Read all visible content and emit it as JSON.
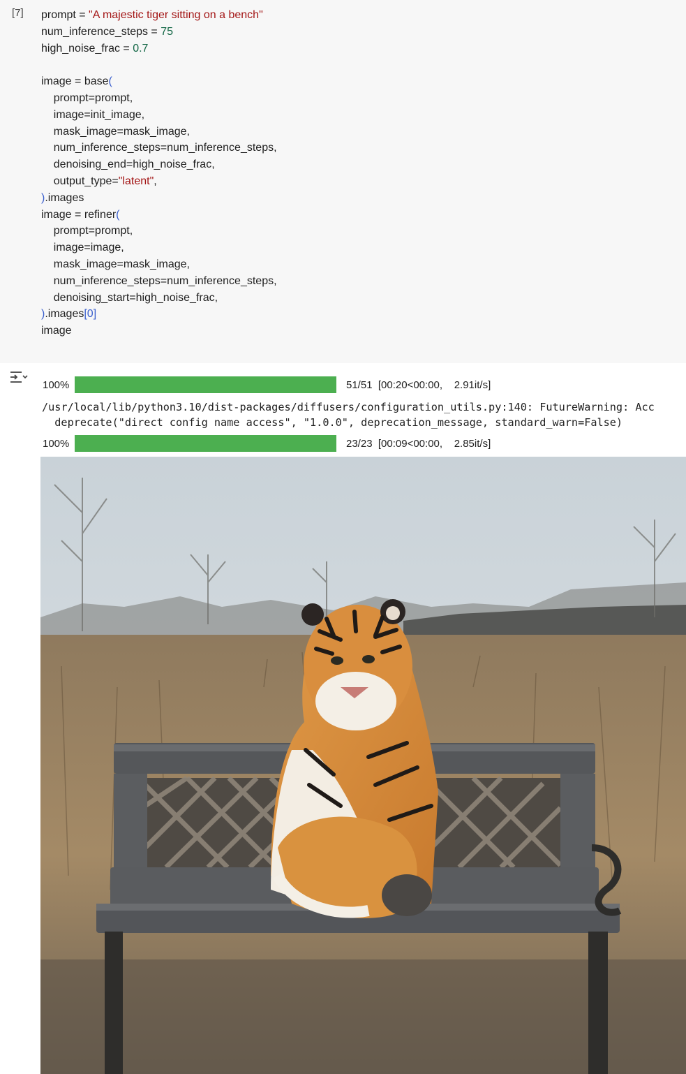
{
  "cell": {
    "execution_count": "[7]",
    "code_lines": [
      [
        {
          "t": "prompt = "
        },
        {
          "t": "\"A majestic tiger sitting on a bench\"",
          "c": "str"
        }
      ],
      [
        {
          "t": "num_inference_steps = "
        },
        {
          "t": "75",
          "c": "num"
        }
      ],
      [
        {
          "t": "high_noise_frac = "
        },
        {
          "t": "0.7",
          "c": "num"
        }
      ],
      [],
      [
        {
          "t": "image = base"
        },
        {
          "t": "(",
          "c": "paren"
        }
      ],
      [
        {
          "t": "    prompt=prompt,"
        }
      ],
      [
        {
          "t": "    image=init_image,"
        }
      ],
      [
        {
          "t": "    mask_image=mask_image,"
        }
      ],
      [
        {
          "t": "    num_inference_steps=num_inference_steps,"
        }
      ],
      [
        {
          "t": "    denoising_end=high_noise_frac,"
        }
      ],
      [
        {
          "t": "    output_type="
        },
        {
          "t": "\"latent\"",
          "c": "str"
        },
        {
          "t": ","
        }
      ],
      [
        {
          "t": ")",
          "c": "paren"
        },
        {
          "t": ".images"
        }
      ],
      [
        {
          "t": "image = refiner"
        },
        {
          "t": "(",
          "c": "paren"
        }
      ],
      [
        {
          "t": "    prompt=prompt,"
        }
      ],
      [
        {
          "t": "    image=image,"
        }
      ],
      [
        {
          "t": "    mask_image=mask_image,"
        }
      ],
      [
        {
          "t": "    num_inference_steps=num_inference_steps,"
        }
      ],
      [
        {
          "t": "    denoising_start=high_noise_frac,"
        }
      ],
      [
        {
          "t": ")",
          "c": "paren"
        },
        {
          "t": ".images"
        },
        {
          "t": "[0]",
          "c": "paren"
        }
      ],
      [
        {
          "t": "image"
        }
      ]
    ]
  },
  "output": {
    "progress1": {
      "percent_label": "100%",
      "fraction": 1.0,
      "stats": "51/51  [00:20<00:00,    2.91it/s]"
    },
    "warning_line1": "/usr/local/lib/python3.10/dist-packages/diffusers/configuration_utils.py:140: FutureWarning: Acc",
    "warning_line2": "  deprecate(\"direct config name access\", \"1.0.0\", deprecation_message, standard_warn=False)",
    "progress2": {
      "percent_label": "100%",
      "fraction": 1.0,
      "stats": "23/23  [00:09<00:00,    2.85it/s]"
    }
  },
  "colors": {
    "progress_fill": "#4caf50",
    "string": "#a31515",
    "number": "#116644",
    "bracket": "#3a5fcd"
  },
  "icons": {
    "output_toggle": "output-collapse-icon"
  }
}
